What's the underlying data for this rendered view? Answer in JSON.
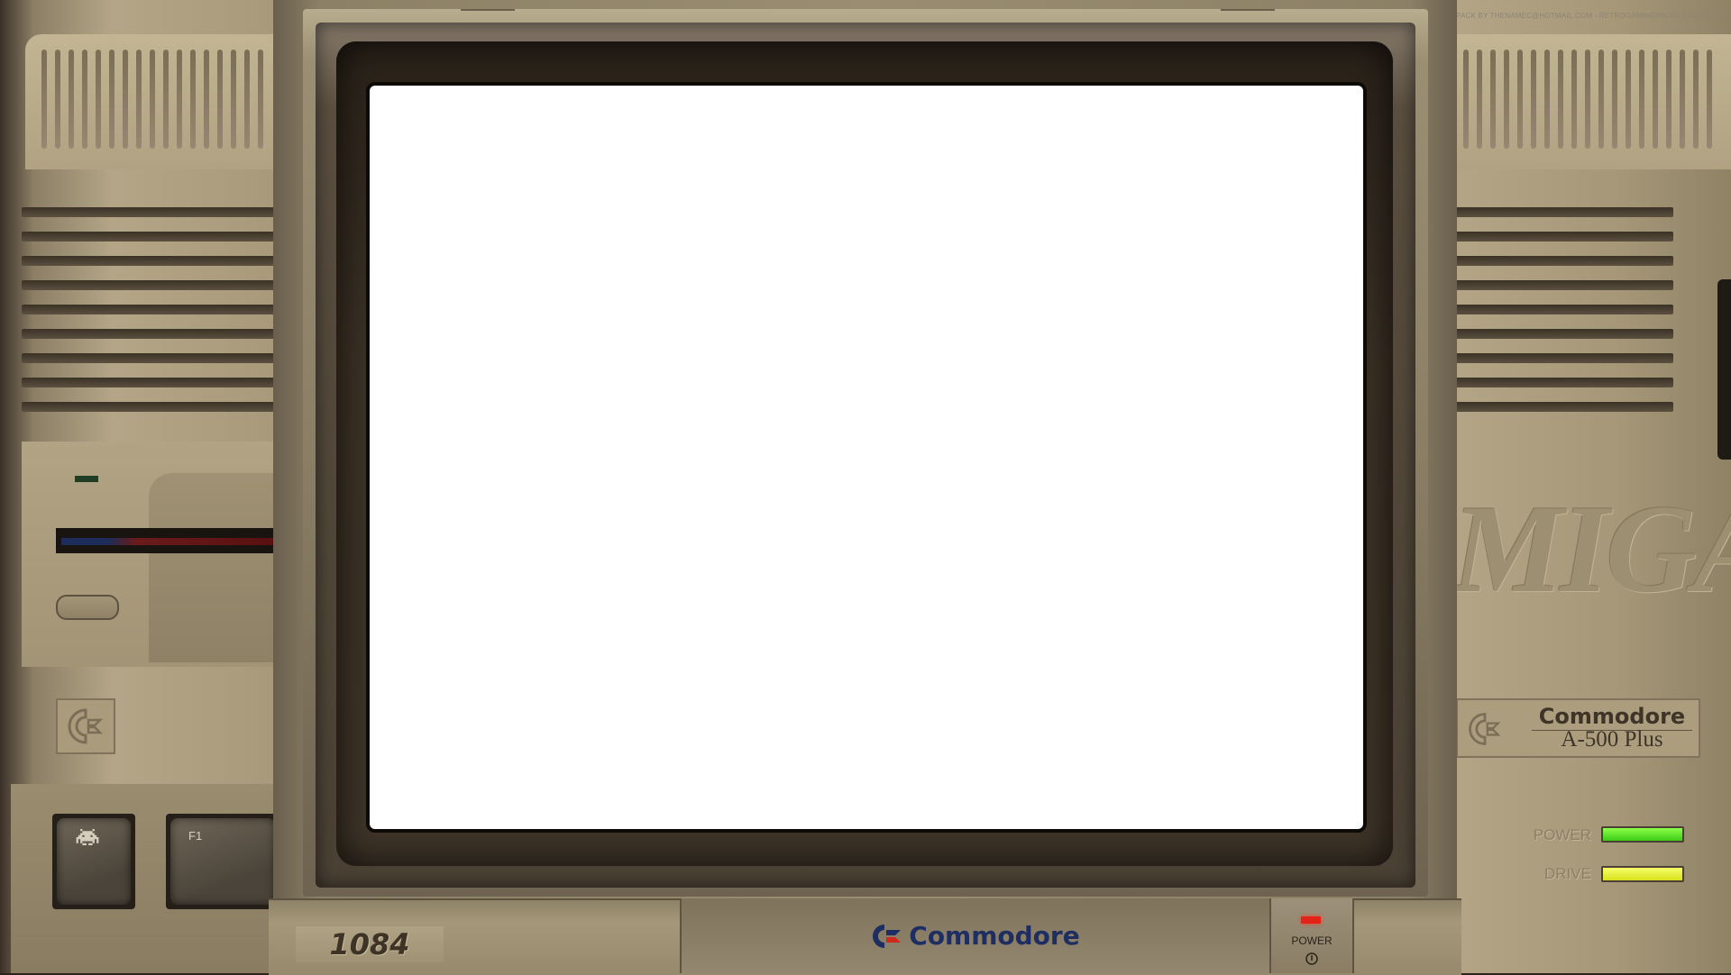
{
  "credit": "PACK BY THENAMEC@HOTMAIL.COM - RETROGAMINGPACKS.BLOGSPOT.COM",
  "left_case": {
    "keys": [
      {
        "label": ""
      },
      {
        "label": "F1"
      }
    ]
  },
  "right_case": {
    "logo_text": "MIGA",
    "badge": {
      "brand": "Commodore",
      "model": "A-500 Plus"
    },
    "leds": {
      "power_label": "POWER",
      "drive_label": "DRIVE"
    }
  },
  "monitor": {
    "model": "1084",
    "brand": "Commodore",
    "power_label": "POWER"
  },
  "colors": {
    "screen": "#ffffff",
    "power_led_green": "#3dcc14",
    "drive_led_yellow": "#d8e11a",
    "monitor_power_led": "#e32218",
    "commodore_blue": "#1f2e62",
    "commodore_red": "#d0281c"
  }
}
